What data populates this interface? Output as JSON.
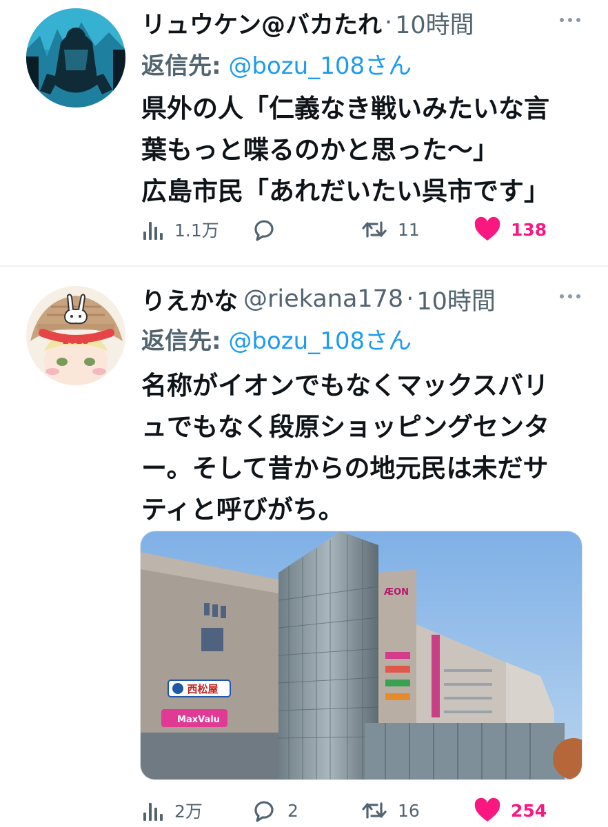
{
  "tweets": [
    {
      "display_name": "リュウケン@バカたれ",
      "handle": "",
      "separator": "·",
      "time": "10時間",
      "reply_label": "返信先:",
      "reply_target": "@bozu_108さん",
      "text_lines": [
        "県外の人「仁義なき戦いみたいな言",
        "葉もっと喋るのかと思った〜」",
        "広島市民「あれだいたい呉市です」"
      ],
      "stats": {
        "views": "1.1万",
        "replies": "",
        "retweets": "11",
        "likes": "138"
      }
    },
    {
      "display_name": "りえかな",
      "handle": "@riekana178",
      "separator": "·",
      "time": "10時間",
      "reply_label": "返信先:",
      "reply_target": "@bozu_108さん",
      "text_lines": [
        "名称がイオンでもなくマックスバリ",
        "ュでもなく段原ショッピングセンタ",
        "ー。そして昔からの地元民は未だサ",
        "ティと呼びがち。"
      ],
      "avatar_badge": "2023",
      "media_signs": {
        "aeon": "ÆON",
        "nishimatsuya": "西松屋",
        "maxvalu": "MaxValu"
      },
      "stats": {
        "views": "2万",
        "replies": "2",
        "retweets": "16",
        "likes": "254"
      }
    }
  ],
  "colors": {
    "text": "#0f1419",
    "secondary": "#536471",
    "link": "#1d9bf0",
    "like": "#f91880",
    "divider": "#eff3f4"
  },
  "icons": [
    "views-icon",
    "reply-icon",
    "retweet-icon",
    "like-icon",
    "more-icon"
  ]
}
